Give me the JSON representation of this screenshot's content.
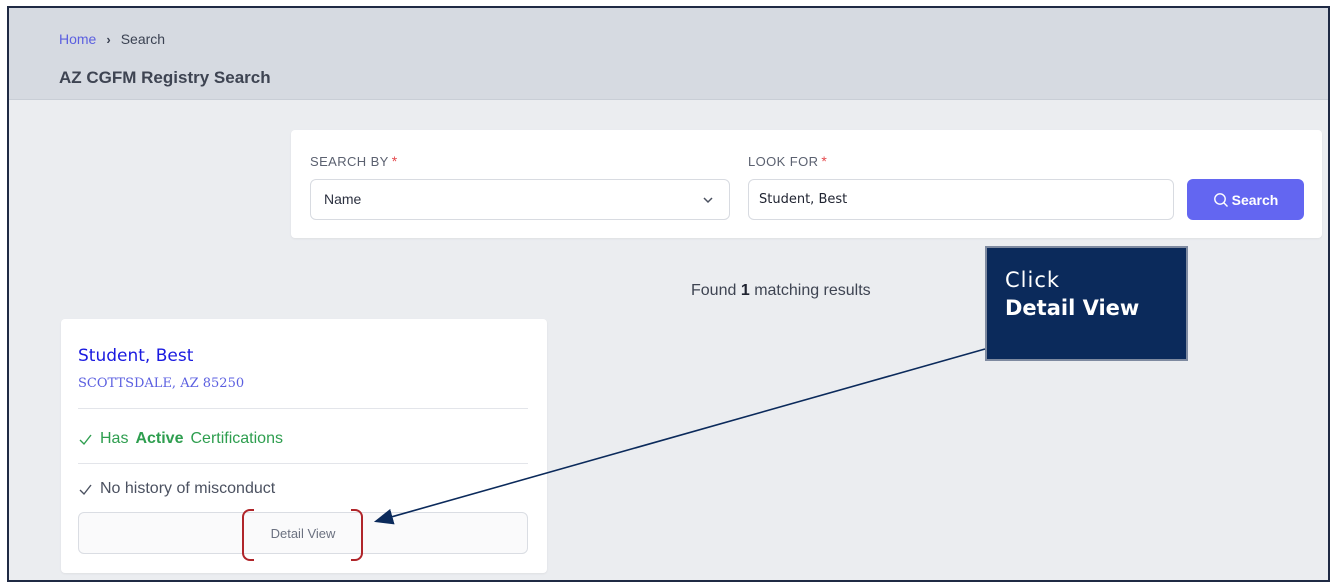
{
  "breadcrumb": {
    "home": "Home",
    "separator": "›",
    "current": "Search"
  },
  "page_title": "AZ CGFM Registry Search",
  "search": {
    "search_by_label": "SEARCH BY",
    "required_mark": "*",
    "search_by_value": "Name",
    "look_for_label": "LOOK FOR",
    "look_for_value": "Student, Best",
    "button_label": "Search"
  },
  "results": {
    "prefix": "Found",
    "count": "1",
    "suffix": "matching results"
  },
  "callout": {
    "line1": "Click",
    "line2": "Detail View"
  },
  "result_card": {
    "name": "Student, Best",
    "location": "SCOTTSDALE, AZ 85250",
    "cert_prefix": "Has",
    "cert_status": "Active",
    "cert_suffix": "Certifications",
    "misconduct": "No history of misconduct",
    "detail_button": "Detail View"
  },
  "colors": {
    "accent": "#6366f1",
    "link": "#5b5fe0",
    "success": "#2e9e4f",
    "callout_bg": "#0b2a5b",
    "highlight": "#b0252a",
    "required": "#e5484d"
  },
  "icons": [
    "chevron-down-icon",
    "search-icon",
    "check-icon",
    "arrow-annotation"
  ]
}
